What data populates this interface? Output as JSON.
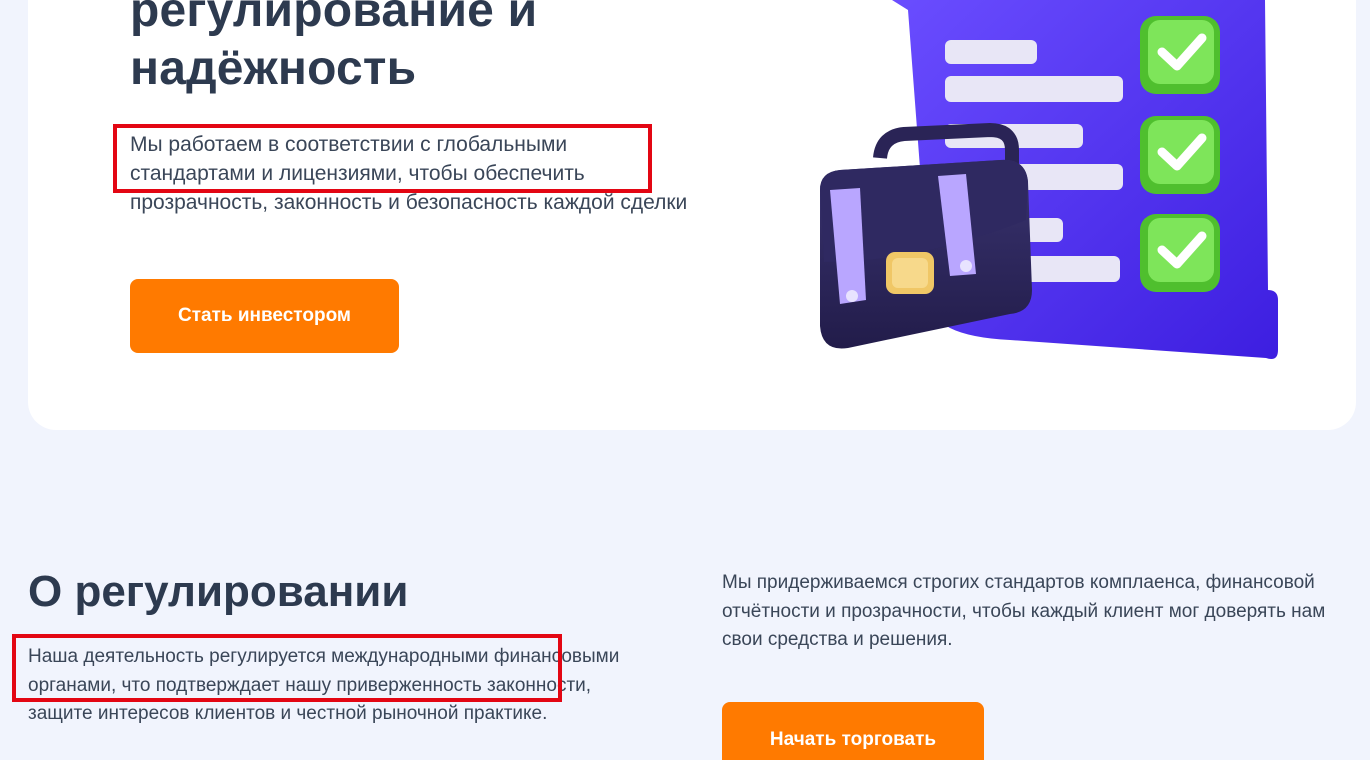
{
  "hero": {
    "title_line1": "регулирование и",
    "title_line2": "надёжность",
    "description": "Мы работаем в соответствии с глобальными стандартами и лицензиями, чтобы обеспечить прозрачность, законность и безопасность каждой сделки",
    "cta_label": "Стать инвестором"
  },
  "regulation": {
    "title": "О регулировании",
    "left_text": "Наша деятельность регулируется международными финансовыми органами, что подтверждает нашу приверженность законности, защите интересов клиентов и честной рыночной практике.",
    "right_text": "Мы придерживаемся строгих стандартов комплаенса, финансовой отчётности и прозрачности, чтобы каждый клиент мог доверять нам свои средства и решения.",
    "cta_label": "Начать торговать"
  },
  "illustration": {
    "icon": "briefcase-checklist-icon"
  },
  "colors": {
    "accent": "#ff7a00",
    "highlight": "#e30613",
    "background": "#f1f4fd",
    "text": "#2d3a4f",
    "checklist": "#5b2ef0",
    "check": "#6fdc45"
  }
}
